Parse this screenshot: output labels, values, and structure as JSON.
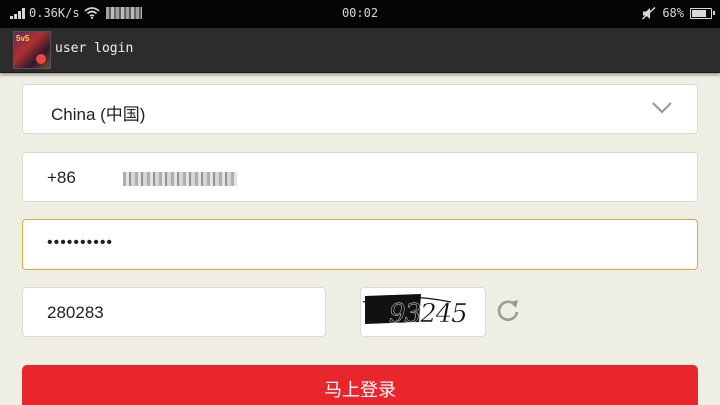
{
  "status_bar": {
    "net_speed": "0.36K/s",
    "time": "00:02",
    "battery": "68%"
  },
  "title_bar": {
    "title": "user  login"
  },
  "form": {
    "country_value": "China (中国)",
    "phone_code": "+86",
    "password_value": "••••••••••",
    "captcha_value": "280283",
    "captcha_text": "93245",
    "submit_label": "马上登录"
  },
  "colors": {
    "accent": "#e8262b",
    "focus_border": "#dba73a",
    "background": "#efeee3"
  },
  "icons": [
    "signal-icon",
    "wifi-icon",
    "mute-icon",
    "battery-icon",
    "chevron-down-icon",
    "refresh-icon"
  ]
}
